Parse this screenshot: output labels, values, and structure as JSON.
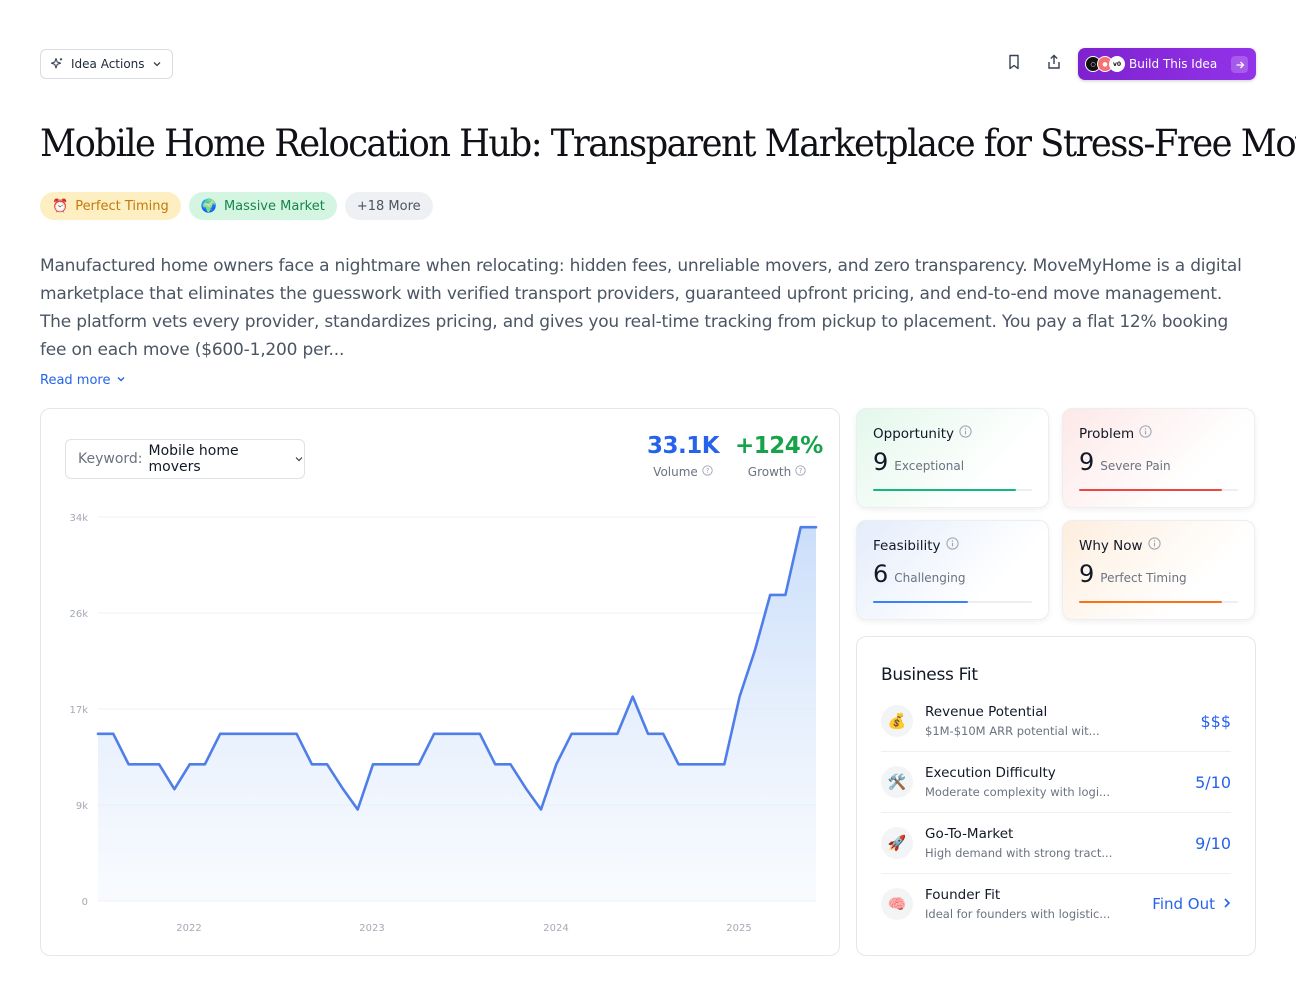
{
  "toolbar": {
    "idea_actions_label": "Idea Actions",
    "build_label": "Build This Idea"
  },
  "title": "Mobile Home Relocation Hub: Transparent Marketplace for Stress-Free Moves",
  "tags": [
    {
      "emoji": "⏰",
      "label": "Perfect Timing"
    },
    {
      "emoji": "🌍",
      "label": "Massive Market"
    },
    {
      "label": "+18 More"
    }
  ],
  "description": "Manufactured home owners face a nightmare when relocating: hidden fees, unreliable movers, and zero transparency. MoveMyHome is a digital marketplace that eliminates the guesswork with verified transport providers, guaranteed upfront pricing, and end-to-end move management. The platform vets every provider, standardizes pricing, and gives you real-time tracking from pickup to placement. You pay a flat 12% booking fee on each move ($600-1,200 per...",
  "read_more": "Read more",
  "keyword": {
    "label": "Keyword:",
    "value": "Mobile home movers"
  },
  "metrics": {
    "volume": {
      "value": "33.1K",
      "label": "Volume",
      "color": "#2563eb"
    },
    "growth": {
      "value": "+124%",
      "label": "Growth",
      "color": "#16a34a"
    }
  },
  "chart_data": {
    "type": "area",
    "xlabel": "",
    "ylabel": "",
    "y_ticks": [
      "0",
      "9k",
      "17k",
      "26k",
      "34k"
    ],
    "y_tick_values": [
      0,
      8500,
      17000,
      25500,
      34000
    ],
    "x_ticks": [
      "2022",
      "2023",
      "2024",
      "2025"
    ],
    "ylim": [
      0,
      34000
    ],
    "series": [
      {
        "color": "#4f7ee8",
        "values": [
          14800,
          14800,
          12100,
          12100,
          12100,
          9900,
          12100,
          12100,
          14800,
          14800,
          14800,
          14800,
          14800,
          14800,
          12100,
          12100,
          10000,
          8100,
          12100,
          12100,
          12100,
          12100,
          14800,
          14800,
          14800,
          14800,
          12100,
          12100,
          10000,
          8100,
          12100,
          14800,
          14800,
          14800,
          14800,
          18100,
          14800,
          14800,
          12100,
          12100,
          12100,
          12100,
          18100,
          22200,
          27100,
          27100,
          33100,
          33100
        ]
      }
    ]
  },
  "scores": [
    {
      "name": "Opportunity",
      "score": "9",
      "label": "Exceptional",
      "fill": 0.9,
      "color": "#10b981"
    },
    {
      "name": "Problem",
      "score": "9",
      "label": "Severe Pain",
      "fill": 0.9,
      "color": "#ef4444"
    },
    {
      "name": "Feasibility",
      "score": "6",
      "label": "Challenging",
      "fill": 0.6,
      "color": "#3b82f6"
    },
    {
      "name": "Why Now",
      "score": "9",
      "label": "Perfect Timing",
      "fill": 0.9,
      "color": "#f97316"
    }
  ],
  "business_fit": {
    "title": "Business Fit",
    "items": [
      {
        "icon": "💰",
        "title": "Revenue Potential",
        "desc": "$1M-$10M ARR potential wit...",
        "value": "$$$"
      },
      {
        "icon": "🛠️",
        "title": "Execution Difficulty",
        "desc": "Moderate complexity with logi...",
        "value": "5/10"
      },
      {
        "icon": "🚀",
        "title": "Go-To-Market",
        "desc": "High demand with strong tract...",
        "value": "9/10"
      },
      {
        "icon": "🧠",
        "title": "Founder Fit",
        "desc": "Ideal for founders with logistic...",
        "value": "Find Out"
      }
    ]
  }
}
